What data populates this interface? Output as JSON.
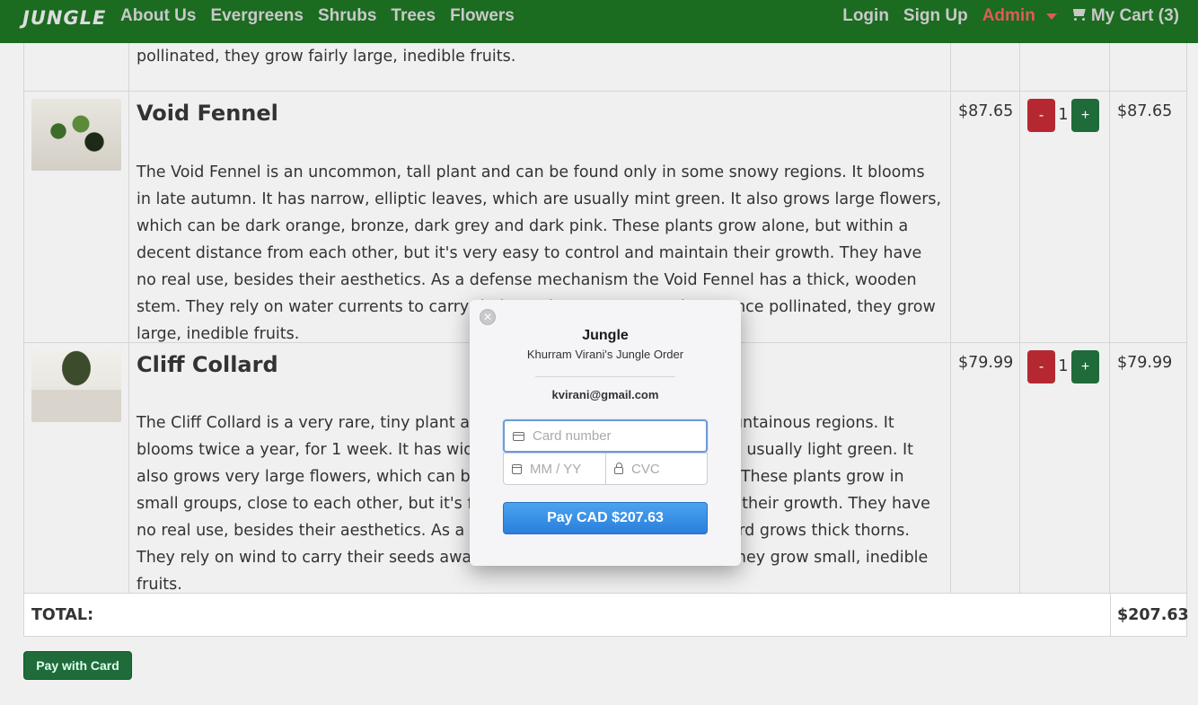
{
  "navbar": {
    "brand": "JUNGLE",
    "left_links": [
      "About Us",
      "Evergreens",
      "Shrubs",
      "Trees",
      "Flowers"
    ],
    "login": "Login",
    "signup": "Sign Up",
    "admin": "Admin",
    "cart": "My Cart (3)"
  },
  "products": [
    {
      "desc_tail": "pollinated, they grow fairly large, inedible fruits."
    },
    {
      "name": "Void Fennel",
      "description": "The Void Fennel is an uncommon, tall plant and can be found only in some snowy regions. It blooms in late autumn. It has narrow, elliptic leaves, which are usually mint green. It also grows large flowers, which can be dark orange, bronze, dark grey and dark pink. These plants grow alone, but within a decent distance from each other, but it's very easy to control and maintain their growth. They have no real use, besides their aesthetics. As a defense mechanism the Void Fennel has a thick, wooden stem. They rely on water currents to carry their seeds away to reproduce. Once pollinated, they grow large, inedible fruits.",
      "price": "$87.65",
      "qty": "1",
      "total": "$87.65",
      "minus": "-",
      "plus": "+"
    },
    {
      "name": "Cliff Collard",
      "description": "The Cliff Collard is a very rare, tiny plant and can be found only in some mountainous regions. It blooms twice a year, for 1 week. It has wide, spear shaped leaves, which are usually light green. It also grows very large flowers, which can be silver, light brown and light red. These plants grow in small groups, close to each other, but it's fairly hard to control and maintain their growth. They have no real use, besides their aesthetics. As a defense mechanism the Cliff Collard grows thick thorns. They rely on wind to carry their seeds away to reproduce. Once pollinated, they grow small, inedible fruits.",
      "price": "$79.99",
      "qty": "1",
      "total": "$79.99",
      "minus": "-",
      "plus": "+"
    }
  ],
  "total": {
    "label": "TOTAL:",
    "value": "$207.63"
  },
  "pay_with_card": "Pay with Card",
  "checkout": {
    "title": "Jungle",
    "subtitle": "Khurram Virani's Jungle Order",
    "email": "kvirani@gmail.com",
    "card_placeholder": "Card number",
    "exp_placeholder": "MM / YY",
    "cvc_placeholder": "CVC",
    "pay_button": "Pay CAD $207.63",
    "close_glyph": "✕"
  }
}
